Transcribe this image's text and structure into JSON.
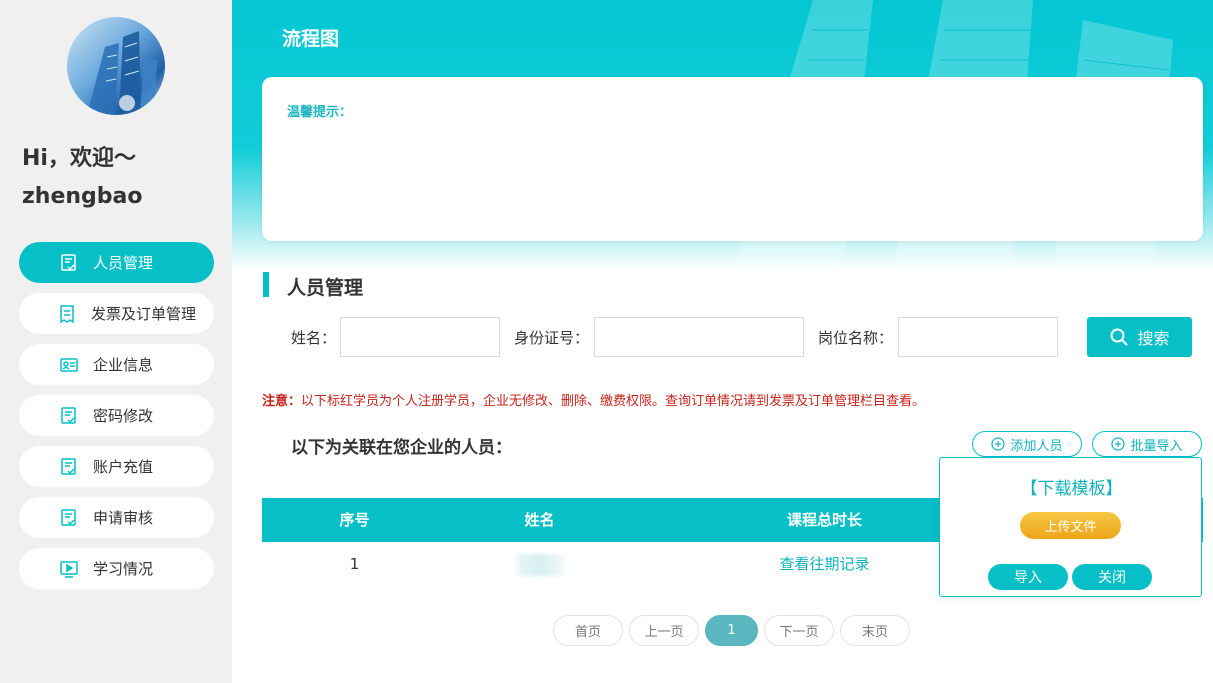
{
  "user": {
    "greeting": "Hi，欢迎～",
    "username": "zhengbao"
  },
  "sidebar": {
    "items": [
      {
        "label": "人员管理",
        "icon": "document-check-icon",
        "active": true
      },
      {
        "label": "发票及订单管理",
        "icon": "receipt-icon",
        "active": false
      },
      {
        "label": "企业信息",
        "icon": "id-card-icon",
        "active": false
      },
      {
        "label": "密码修改",
        "icon": "document-check-icon",
        "active": false
      },
      {
        "label": "账户充值",
        "icon": "document-check-icon",
        "active": false
      },
      {
        "label": "申请审核",
        "icon": "document-check-icon",
        "active": false
      },
      {
        "label": "学习情况",
        "icon": "video-play-icon",
        "active": false
      }
    ]
  },
  "header": {
    "title": "流程图"
  },
  "tips": {
    "label": "温馨提示："
  },
  "section": {
    "title": "人员管理"
  },
  "search": {
    "name_label": "姓名：",
    "name_value": "",
    "id_label": "身份证号：",
    "id_value": "",
    "position_label": "岗位名称：",
    "position_value": "",
    "button_label": "搜索"
  },
  "notice": {
    "prefix": "注意：",
    "text": "以下标红学员为个人注册学员，企业无修改、删除、缴费权限。查询订单情况请到发票及订单管理栏目查看。"
  },
  "list": {
    "title": "以下为关联在您企业的人员：",
    "add_label": "添加人员",
    "batch_import_label": "批量导入"
  },
  "table": {
    "headers": [
      "序号",
      "姓名",
      "课程总时长"
    ],
    "rows": [
      {
        "index": "1",
        "name": "",
        "action": "查看往期记录"
      }
    ]
  },
  "pagination": {
    "first": "首页",
    "prev": "上一页",
    "current": "1",
    "next": "下一页",
    "last": "末页"
  },
  "import_popup": {
    "title": "【下载模板】",
    "upload_label": "上传文件",
    "import_label": "导入",
    "close_label": "关闭"
  },
  "colors": {
    "accent": "#06bfc7",
    "warning": "#c8231b",
    "upload": "#eda51b",
    "pager_current": "#5ab7c0"
  }
}
